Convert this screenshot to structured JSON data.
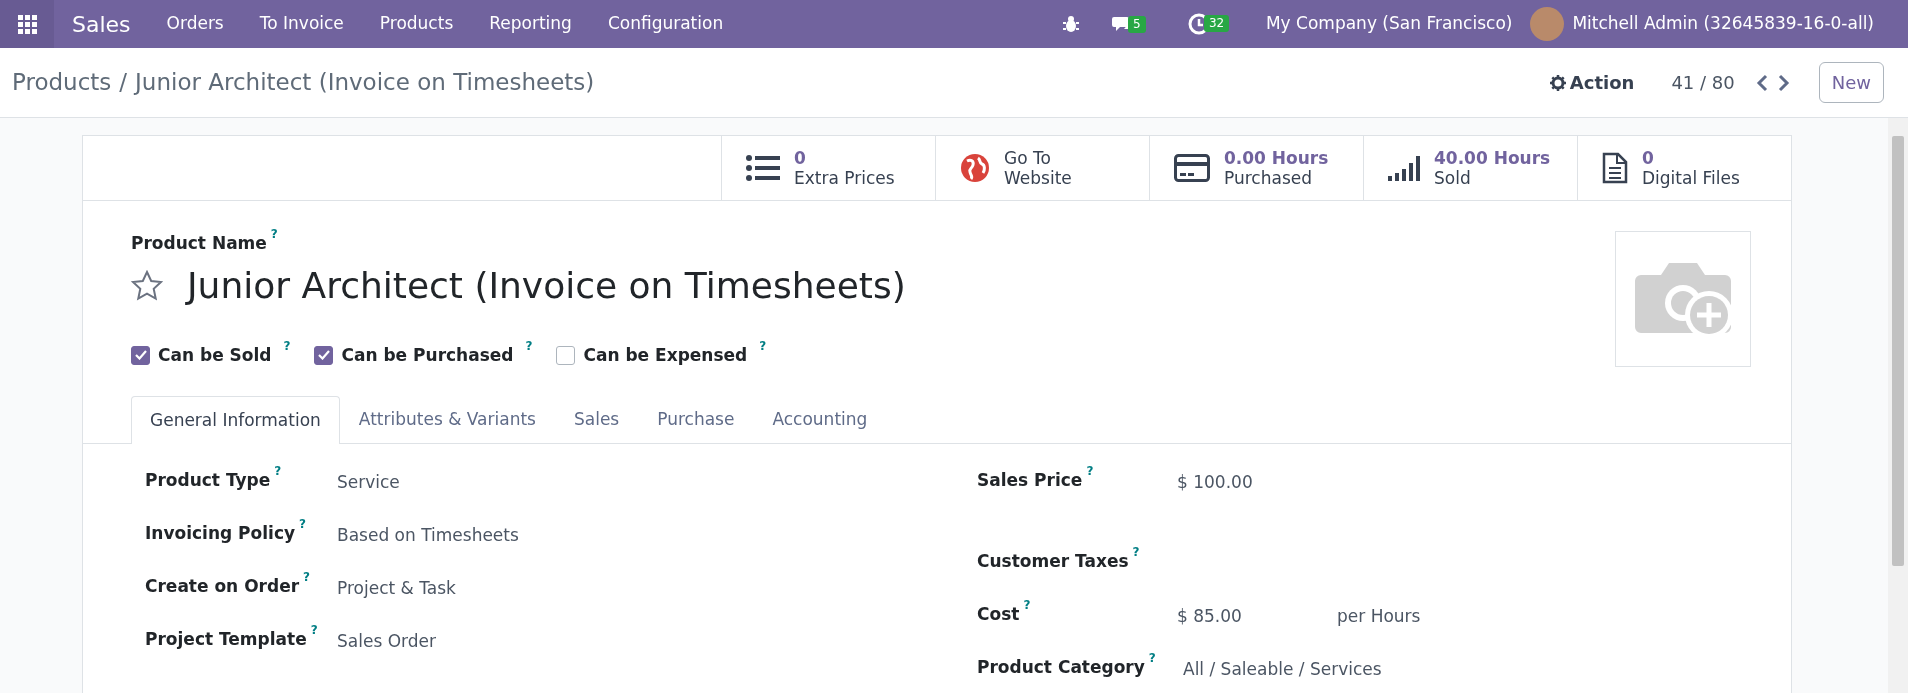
{
  "navbar": {
    "app": "Sales",
    "menu": [
      "Orders",
      "To Invoice",
      "Products",
      "Reporting",
      "Configuration"
    ],
    "messages_count": "5",
    "activities_count": "32",
    "company": "My Company (San Francisco)",
    "user": "Mitchell Admin (32645839-16-0-all)"
  },
  "breadcrumb": {
    "parent": "Products",
    "separator": "/",
    "current": "Junior Architect (Invoice on Timesheets)"
  },
  "control": {
    "action": "Action",
    "pager": "41 / 80",
    "new_button": "New"
  },
  "stat_buttons": [
    {
      "kind": "list",
      "value": "0",
      "label": "Extra Prices"
    },
    {
      "kind": "globe",
      "value": "Go To",
      "label": "Website"
    },
    {
      "kind": "card",
      "value": "0.00 Hours",
      "label": "Purchased"
    },
    {
      "kind": "signal",
      "value": "40.00 Hours",
      "label": "Sold"
    },
    {
      "kind": "file",
      "value": "0",
      "label": "Digital Files"
    }
  ],
  "product": {
    "name_label": "Product Name",
    "help": "?",
    "name": "Junior Architect (Invoice on Timesheets)",
    "favorite": false
  },
  "options": [
    {
      "label": "Can be Sold",
      "help": "?",
      "checked": true
    },
    {
      "label": "Can be Purchased",
      "help": "?",
      "checked": true
    },
    {
      "label": "Can be Expensed",
      "help": "?",
      "checked": false
    }
  ],
  "tabs": [
    {
      "label": "General Information",
      "selected": true
    },
    {
      "label": "Attributes & Variants",
      "selected": false
    },
    {
      "label": "Sales",
      "selected": false
    },
    {
      "label": "Purchase",
      "selected": false
    },
    {
      "label": "Accounting",
      "selected": false
    }
  ],
  "left_fields": [
    {
      "label": "Product Type",
      "help": "?",
      "value": "Service"
    },
    {
      "label": "Invoicing Policy",
      "help": "?",
      "value": "Based on Timesheets"
    },
    {
      "label": "Create on Order",
      "help": "?",
      "value": "Project & Task"
    },
    {
      "label": "Project Template",
      "help": "?",
      "value": "Sales Order"
    }
  ],
  "right_fields": [
    {
      "label": "Sales Price",
      "help": "?",
      "value": "$ 100.00"
    },
    {
      "label": "Customer Taxes",
      "help": "?"
    },
    {
      "label": "Cost",
      "help": "?",
      "value": "$ 85.00",
      "unit": "per Hours"
    },
    {
      "label": "Product Category",
      "help": "?",
      "value": "All / Saleable / Services"
    }
  ]
}
